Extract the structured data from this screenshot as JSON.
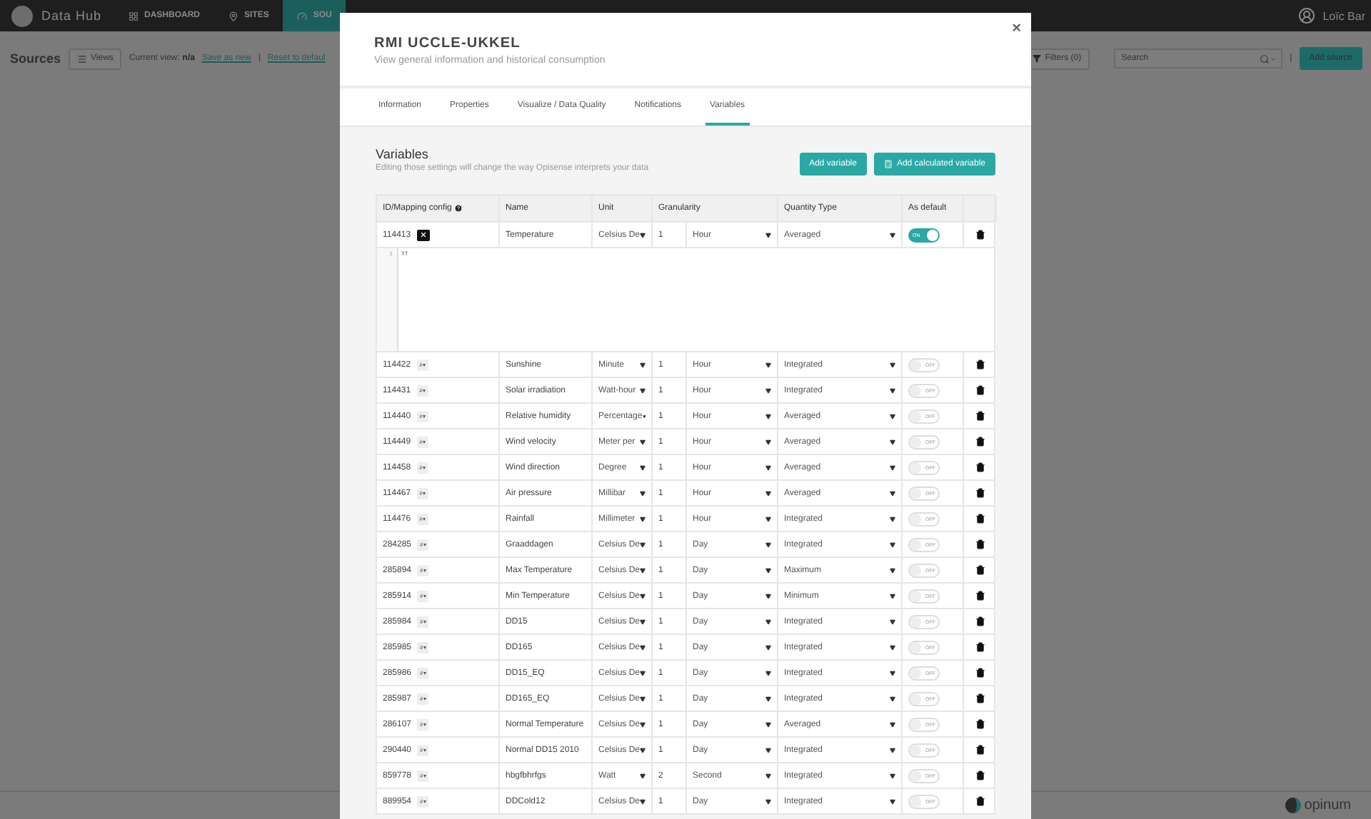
{
  "topbar": {
    "brand": "Data Hub",
    "nav": [
      {
        "label": "DASHBOARD",
        "selected": false
      },
      {
        "label": "SITES",
        "selected": false
      },
      {
        "label": "SOU",
        "selected": true
      }
    ],
    "user": "Loïc Bar"
  },
  "toolbar": {
    "title": "Sources",
    "views_button": "Views",
    "current_view_label": "Current view:",
    "current_view_value": "n/a",
    "save_link": "Save as new",
    "separator": "|",
    "reset_link": "Reset to defaul",
    "filters_button": "Filters (0)",
    "search": {
      "placeholder": "Search"
    },
    "separator_right": "|",
    "add_button": "Add source"
  },
  "footer": {
    "brand": "opinum"
  },
  "modal": {
    "title": "RMI UCCLE-UKKEL",
    "subtitle": "View general information and historical consumption",
    "close": "×",
    "tabs": [
      {
        "label": "Information",
        "selected": false
      },
      {
        "label": "Properties",
        "selected": false
      },
      {
        "label": "Visualize / Data Quality",
        "selected": false
      },
      {
        "label": "Notifications",
        "selected": false
      },
      {
        "label": "Variables",
        "selected": true
      }
    ],
    "section_title": "Variables",
    "section_subtitle": "Editing those settings will change the way Opisense interprets your data",
    "buttons": [
      {
        "label": "Add variable"
      },
      {
        "label": "Add calculated variable"
      }
    ],
    "table": {
      "columns": [
        "ID/Mapping config",
        "Name",
        "Unit",
        "Granularity",
        "Quantity Type",
        "As default"
      ],
      "rows": [
        {
          "id": "114413",
          "mapping_open": true,
          "name": "Temperature",
          "unit": "Celsius De",
          "count": "1",
          "granularity": "Hour",
          "quantity": "Averaged",
          "default": true,
          "toggle": "ON",
          "editor": [
            {
              "number": "1",
              "text": "TT"
            }
          ]
        },
        {
          "id": "114422",
          "mapping_open": false,
          "mapping_badge": "#▾",
          "name": "Sunshine",
          "unit": "Minute",
          "count": "1",
          "granularity": "Hour",
          "quantity": "Integrated",
          "default": false,
          "toggle": "OFF"
        },
        {
          "id": "114431",
          "mapping_open": false,
          "mapping_badge": "#▾",
          "name": "Solar irradiation",
          "unit": "Watt-hour",
          "count": "1",
          "granularity": "Hour",
          "quantity": "Integrated",
          "default": false,
          "toggle": "OFF"
        },
        {
          "id": "114440",
          "mapping_open": false,
          "mapping_badge": "#▾",
          "name": "Relative humidity",
          "unit": "Percentage",
          "count": "1",
          "granularity": "Hour",
          "quantity": "Averaged",
          "default": false,
          "toggle": "OFF"
        },
        {
          "id": "114449",
          "mapping_open": false,
          "mapping_badge": "#▾",
          "name": "Wind velocity",
          "unit": "Meter per",
          "count": "1",
          "granularity": "Hour",
          "quantity": "Averaged",
          "default": false,
          "toggle": "OFF"
        },
        {
          "id": "114458",
          "mapping_open": false,
          "mapping_badge": "#▾",
          "name": "Wind direction",
          "unit": "Degree",
          "count": "1",
          "granularity": "Hour",
          "quantity": "Averaged",
          "default": false,
          "toggle": "OFF"
        },
        {
          "id": "114467",
          "mapping_open": false,
          "mapping_badge": "#▾",
          "name": "Air pressure",
          "unit": "Millibar",
          "count": "1",
          "granularity": "Hour",
          "quantity": "Averaged",
          "default": false,
          "toggle": "OFF"
        },
        {
          "id": "114476",
          "mapping_open": false,
          "mapping_badge": "#▾",
          "name": "Rainfall",
          "unit": "Millimeter",
          "count": "1",
          "granularity": "Hour",
          "quantity": "Integrated",
          "default": false,
          "toggle": "OFF"
        },
        {
          "id": "284285",
          "mapping_open": false,
          "mapping_badge": "#▾",
          "name": "Graaddagen",
          "unit": "Celsius De",
          "count": "1",
          "granularity": "Day",
          "quantity": "Integrated",
          "default": false,
          "toggle": "OFF"
        },
        {
          "id": "285894",
          "mapping_open": false,
          "mapping_badge": "#▾",
          "name": "Max Temperature",
          "unit": "Celsius De",
          "count": "1",
          "granularity": "Day",
          "quantity": "Maximum",
          "default": false,
          "toggle": "OFF"
        },
        {
          "id": "285914",
          "mapping_open": false,
          "mapping_badge": "#▾",
          "name": "Min Temperature",
          "unit": "Celsius De",
          "count": "1",
          "granularity": "Day",
          "quantity": "Minimum",
          "default": false,
          "toggle": "OFF"
        },
        {
          "id": "285984",
          "mapping_open": false,
          "mapping_badge": "#▾",
          "name": "DD15",
          "unit": "Celsius De",
          "count": "1",
          "granularity": "Day",
          "quantity": "Integrated",
          "default": false,
          "toggle": "OFF"
        },
        {
          "id": "285985",
          "mapping_open": false,
          "mapping_badge": "#▾",
          "name": "DD165",
          "unit": "Celsius De",
          "count": "1",
          "granularity": "Day",
          "quantity": "Integrated",
          "default": false,
          "toggle": "OFF"
        },
        {
          "id": "285986",
          "mapping_open": false,
          "mapping_badge": "#▾",
          "name": "DD15_EQ",
          "unit": "Celsius De",
          "count": "1",
          "granularity": "Day",
          "quantity": "Integrated",
          "default": false,
          "toggle": "OFF"
        },
        {
          "id": "285987",
          "mapping_open": false,
          "mapping_badge": "#▾",
          "name": "DD165_EQ",
          "unit": "Celsius De",
          "count": "1",
          "granularity": "Day",
          "quantity": "Integrated",
          "default": false,
          "toggle": "OFF"
        },
        {
          "id": "286107",
          "mapping_open": false,
          "mapping_badge": "#▾",
          "name": "Normal Temperature",
          "unit": "Celsius De",
          "count": "1",
          "granularity": "Day",
          "quantity": "Averaged",
          "default": false,
          "toggle": "OFF"
        },
        {
          "id": "290440",
          "mapping_open": false,
          "mapping_badge": "#▾",
          "name": "Normal DD15 2010",
          "unit": "Celsius De",
          "count": "1",
          "granularity": "Day",
          "quantity": "Integrated",
          "default": false,
          "toggle": "OFF"
        },
        {
          "id": "859778",
          "mapping_open": false,
          "mapping_badge": "#▾",
          "name": "hbgfbhrfgs",
          "unit": "Watt",
          "count": "2",
          "granularity": "Second",
          "quantity": "Integrated",
          "default": false,
          "toggle": "OFF"
        },
        {
          "id": "889954",
          "mapping_open": false,
          "mapping_badge": "#▾",
          "name": "DDCold12",
          "unit": "Celsius De",
          "count": "1",
          "granularity": "Day",
          "quantity": "Integrated",
          "default": false,
          "toggle": "OFF"
        }
      ]
    }
  }
}
